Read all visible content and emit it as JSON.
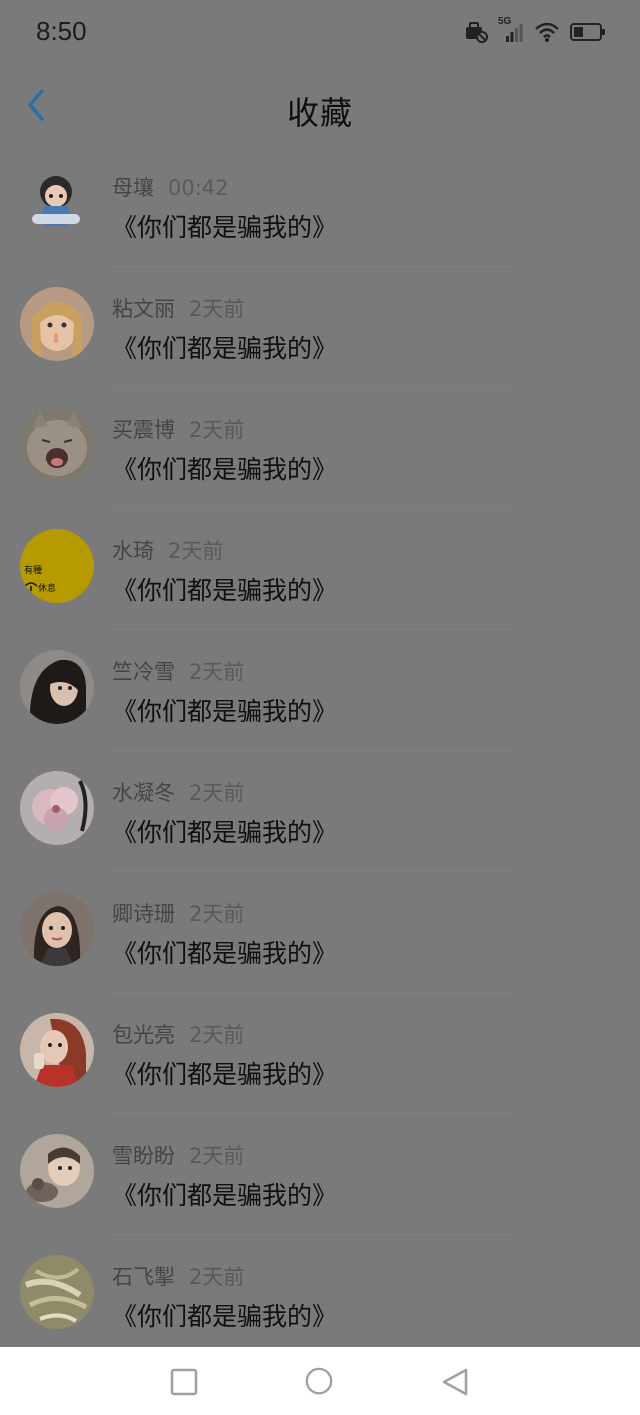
{
  "status_bar": {
    "time": "8:50",
    "network": "5G",
    "icons": [
      "briefcase-icon",
      "signal-icon",
      "wifi-icon",
      "battery-icon"
    ]
  },
  "header": {
    "title": "收藏",
    "back_icon": "chevron-left-icon"
  },
  "items": [
    {
      "name": "母壤",
      "time": "00:42",
      "text": "《你们都是骗我的》",
      "avatar_color": "#cfd8dc"
    },
    {
      "name": "粘文丽",
      "time": "2天前",
      "text": "《你们都是骗我的》",
      "avatar_color": "#c9a58e"
    },
    {
      "name": "买震博",
      "time": "2天前",
      "text": "《你们都是骗我的》",
      "avatar_color": "#8b8378"
    },
    {
      "name": "水琦",
      "time": "2天前",
      "text": "《你们都是骗我的》",
      "avatar_color": "#e3c400",
      "avatar_lines": [
        "有種",
        "休息"
      ]
    },
    {
      "name": "竺冷雪",
      "time": "2天前",
      "text": "《你们都是骗我的》",
      "avatar_color": "#3a2f2a"
    },
    {
      "name": "水凝冬",
      "time": "2天前",
      "text": "《你们都是骗我的》",
      "avatar_color": "#e8d0d6"
    },
    {
      "name": "卿诗珊",
      "time": "2天前",
      "text": "《你们都是骗我的》",
      "avatar_color": "#8c7b70"
    },
    {
      "name": "包光亮",
      "time": "2天前",
      "text": "《你们都是骗我的》",
      "avatar_color": "#c0392b"
    },
    {
      "name": "雪盼盼",
      "time": "2天前",
      "text": "《你们都是骗我的》",
      "avatar_color": "#c4b8ad"
    },
    {
      "name": "石飞掣",
      "time": "2天前",
      "text": "《你们都是骗我的》",
      "avatar_color": "#a9a77a"
    }
  ],
  "nav_bar": {
    "icons": [
      "recent-apps-icon",
      "home-icon",
      "back-icon"
    ]
  }
}
